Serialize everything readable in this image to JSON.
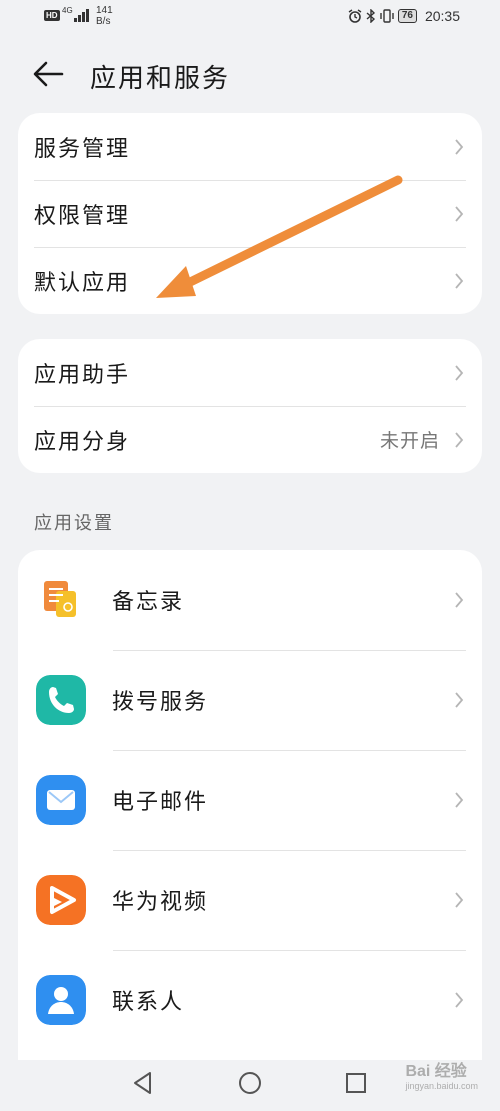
{
  "status_bar": {
    "hd": "HD",
    "network": "4G",
    "speed_value": "141",
    "speed_unit": "B/s",
    "battery": "76",
    "time": "20:35"
  },
  "header": {
    "title": "应用和服务"
  },
  "group1": [
    {
      "label": "服务管理"
    },
    {
      "label": "权限管理"
    },
    {
      "label": "默认应用"
    }
  ],
  "group2": [
    {
      "label": "应用助手",
      "value": ""
    },
    {
      "label": "应用分身",
      "value": "未开启"
    }
  ],
  "section_title": "应用设置",
  "app_settings": [
    {
      "label": "备忘录",
      "icon": "memo-icon"
    },
    {
      "label": "拨号服务",
      "icon": "phone-icon"
    },
    {
      "label": "电子邮件",
      "icon": "email-icon"
    },
    {
      "label": "华为视频",
      "icon": "video-icon"
    },
    {
      "label": "联系人",
      "icon": "contacts-icon"
    }
  ],
  "annotation_color": "#ef8d3a",
  "watermark": {
    "text": "Bai 经验",
    "sub": "jingyan.baidu.com"
  }
}
